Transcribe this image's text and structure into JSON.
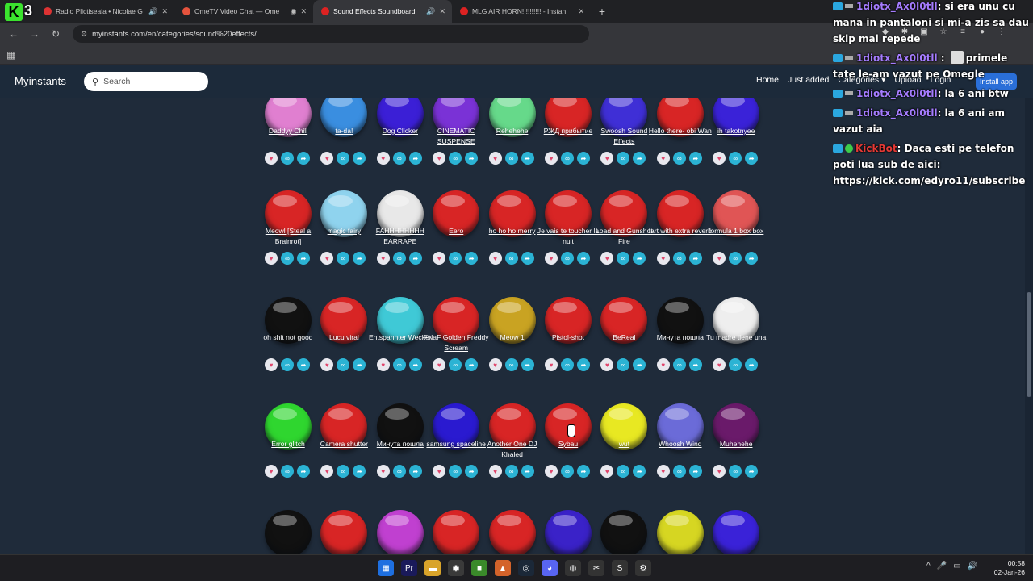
{
  "tabs": [
    {
      "title": "Radio Plictiseala • Nicolae G",
      "favicon_color": "#d33",
      "sound": "🔊",
      "active": false
    },
    {
      "title": "OmeTV Video Chat — Ome",
      "favicon_color": "#e5533d",
      "sound": "◉",
      "active": false
    },
    {
      "title": "Sound Effects Soundboard",
      "favicon_color": "#d22",
      "sound": "🔊",
      "active": true
    },
    {
      "title": "MLG AIR HORN!!!!!!!!!! - Instan",
      "favicon_color": "#d22",
      "sound": "",
      "active": false
    }
  ],
  "new_tab": "+",
  "url": "myinstants.com/en/categories/sound%20effects/",
  "site": {
    "logo": "Myinstants",
    "search_placeholder": "Search",
    "nav": [
      "Home",
      "Just added",
      "Categories ▾",
      "Upload",
      "Login"
    ],
    "install": "Install app"
  },
  "rows": [
    {
      "items": [
        {
          "label": "Daddyy Chill",
          "color": "#e07fd0"
        },
        {
          "label": "ta-da!",
          "color": "#3a8ee0"
        },
        {
          "label": "Dog Clicker",
          "color": "#3b1fd6"
        },
        {
          "label": "CINEMATIC SUSPENSE",
          "color": "#7a32d6"
        },
        {
          "label": "Rehehehe",
          "color": "#66d98a"
        },
        {
          "label": "РЖД прибытие",
          "color": "#d82525"
        },
        {
          "label": "Swoosh Sound Effects",
          "color": "#3f2fd6"
        },
        {
          "label": "Hello there- obi Wan",
          "color": "#d82525"
        },
        {
          "label": "ih takotnyee",
          "color": "#3a22d8"
        }
      ]
    },
    {
      "items": [
        {
          "label": "Meowl [Steal a Brainrot]",
          "color": "#d82525"
        },
        {
          "label": "magic fairy",
          "color": "#8fd3ee"
        },
        {
          "label": "FAHHHHHHHH EARRAPE",
          "color": "#e8e8e8"
        },
        {
          "label": "Eero",
          "color": "#d82525"
        },
        {
          "label": "ho ho ho merry",
          "color": "#d82525"
        },
        {
          "label": "Je vais te toucher la nuit",
          "color": "#d82525"
        },
        {
          "label": "Load and Gunshot Fire",
          "color": "#d82525"
        },
        {
          "label": "fart with extra reverb",
          "color": "#d82525"
        },
        {
          "label": "formula 1 box box",
          "color": "#e05555"
        }
      ]
    },
    {
      "items": [
        {
          "label": "oh shit not good",
          "color": "#111111"
        },
        {
          "label": "Lucu viral",
          "color": "#d82525"
        },
        {
          "label": "Entspannter Wecker",
          "color": "#3fc9d6"
        },
        {
          "label": "FNaF Golden Freddy Scream",
          "color": "#d82525"
        },
        {
          "label": "Meow 1",
          "color": "#c9a322"
        },
        {
          "label": "Pistol-shot",
          "color": "#d82525"
        },
        {
          "label": "BeReal",
          "color": "#d82525"
        },
        {
          "label": "Минута пошла",
          "color": "#111111"
        },
        {
          "label": "Tu madre tiene una",
          "color": "#eeeeee"
        }
      ]
    },
    {
      "items": [
        {
          "label": "Error glitch",
          "color": "#2fd62f"
        },
        {
          "label": "Camera shutter",
          "color": "#d82525"
        },
        {
          "label": "Минута пошла",
          "color": "#111111"
        },
        {
          "label": "samsung spaceline",
          "color": "#2a1ad0"
        },
        {
          "label": "Another One DJ Khaled",
          "color": "#d82525"
        },
        {
          "label": "Sybau",
          "color": "#d82525"
        },
        {
          "label": "wut",
          "color": "#e8e822"
        },
        {
          "label": "Whoosh Wind",
          "color": "#6b6bd8"
        },
        {
          "label": "Muhehehe",
          "color": "#6a1a6a"
        }
      ]
    },
    {
      "items": [
        {
          "label": "",
          "color": "#111111"
        },
        {
          "label": "",
          "color": "#d82525"
        },
        {
          "label": "",
          "color": "#c040d0"
        },
        {
          "label": "",
          "color": "#d82525"
        },
        {
          "label": "",
          "color": "#d82525"
        },
        {
          "label": "",
          "color": "#3a22c8"
        },
        {
          "label": "",
          "color": "#111111"
        },
        {
          "label": "",
          "color": "#d6d622"
        },
        {
          "label": "",
          "color": "#3a22d8"
        }
      ]
    }
  ],
  "overlay": {
    "count": "3",
    "chat": [
      {
        "user": "1diotx_Ax0l0tll",
        "text": ": si era unu cu mana in pantaloni si mi-a zis sa dau skip mai repede"
      },
      {
        "user": "1diotx_Ax0l0tll",
        "text": "primele tate le-am vazut pe Omegle",
        "emote": true
      },
      {
        "user": "1diotx_Ax0l0tll",
        "text": ": la 6 ani btw"
      },
      {
        "user": "1diotx_Ax0l0tll",
        "text": ": la 6 ani am vazut aia"
      },
      {
        "user": "KickBot",
        "text": ": Daca esti pe telefon poti lua sub de aici: https://kick.com/edyro11/subscribe",
        "bot": true
      }
    ]
  },
  "clock": {
    "time": "00:58",
    "date": "02-Jan-26"
  },
  "accent": "#2aa7df"
}
